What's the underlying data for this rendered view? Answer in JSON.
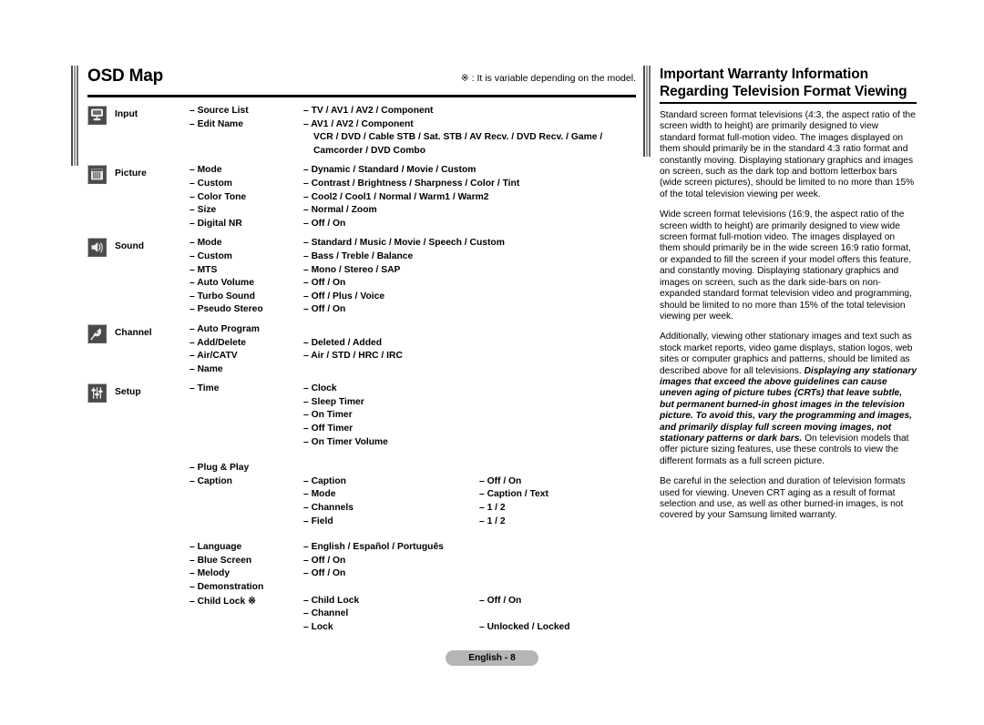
{
  "left": {
    "title": "OSD Map",
    "note": "※ : It is variable depending on the model.",
    "groups": [
      {
        "icon": "input-monitor-icon",
        "label": "Input",
        "rows": [
          {
            "c1": "– Source List",
            "c2": "– TV / AV1 / AV2 / Component"
          },
          {
            "c1": "– Edit Name",
            "c2": "– AV1 / AV2 / Component"
          },
          {
            "cont": "VCR / DVD / Cable STB / Sat. STB / AV Recv. / DVD Recv. / Game /"
          },
          {
            "cont": "Camcorder / DVD Combo"
          }
        ]
      },
      {
        "icon": "picture-blinds-icon",
        "label": "Picture",
        "rows": [
          {
            "c1": "– Mode",
            "c2": "– Dynamic / Standard / Movie / Custom"
          },
          {
            "c1": "– Custom",
            "c2": "– Contrast / Brightness / Sharpness / Color / Tint"
          },
          {
            "c1": "– Color Tone",
            "c2": "– Cool2 / Cool1 / Normal / Warm1 / Warm2"
          },
          {
            "c1": "– Size",
            "c2": "– Normal / Zoom"
          },
          {
            "c1": "– Digital NR",
            "c2": "– Off / On"
          }
        ]
      },
      {
        "icon": "sound-speaker-icon",
        "label": "Sound",
        "rows": [
          {
            "c1": "– Mode",
            "c2": "– Standard / Music / Movie / Speech / Custom"
          },
          {
            "c1": "– Custom",
            "c2": "– Bass / Treble / Balance"
          },
          {
            "c1": "– MTS",
            "c2": "– Mono / Stereo / SAP"
          },
          {
            "c1": "– Auto Volume",
            "c2": "– Off / On"
          },
          {
            "c1": "– Turbo Sound",
            "c2": "– Off / Plus / Voice"
          },
          {
            "c1": "– Pseudo Stereo",
            "c2": "– Off / On"
          }
        ]
      },
      {
        "icon": "channel-satellite-dish-icon",
        "label": "Channel",
        "rows": [
          {
            "c1": "– Auto Program"
          },
          {
            "c1": "– Add/Delete",
            "c2": "– Deleted / Added"
          },
          {
            "c1": "– Air/CATV",
            "c2": "– Air / STD / HRC / IRC"
          },
          {
            "c1": "– Name"
          }
        ]
      },
      {
        "icon": "setup-sliders-icon",
        "label": "Setup",
        "rows": [
          {
            "c1": "– Time",
            "c2": "– Clock"
          },
          {
            "c2": "– Sleep Timer"
          },
          {
            "c2": "– On Timer"
          },
          {
            "c2": "– Off Timer"
          },
          {
            "c2": "– On Timer Volume"
          },
          {
            "spacer": true
          },
          {
            "c1": "– Plug & Play"
          },
          {
            "c1": "– Caption",
            "c2": "– Caption",
            "c4": "– Off / On"
          },
          {
            "c2": "– Mode",
            "c4": "– Caption / Text"
          },
          {
            "c2": "– Channels",
            "c4": "– 1 / 2"
          },
          {
            "c2": "– Field",
            "c4": "– 1 / 2"
          },
          {
            "spacer": true
          },
          {
            "c1": "– Language",
            "c2": "– English / Español / Português"
          },
          {
            "c1": "– Blue Screen",
            "c2": "– Off / On"
          },
          {
            "c1": "– Melody",
            "c2": "– Off / On"
          },
          {
            "c1": "– Demonstration"
          },
          {
            "c1": "– Child Lock ※",
            "c2": "– Child Lock",
            "c4": "– Off / On"
          },
          {
            "c2": "– Channel"
          },
          {
            "c2": "– Lock",
            "c4": "– Unlocked / Locked"
          }
        ]
      }
    ]
  },
  "right": {
    "title_line1": "Important Warranty Information",
    "title_line2": "Regarding Television Format Viewing",
    "paragraphs": [
      {
        "parts": [
          {
            "text": "Standard screen format televisions (4:3, the aspect ratio of the screen width to height) are primarily designed to view standard format full-motion video. The images displayed on them should primarily be in the standard 4:3 ratio format and constantly moving. Displaying stationary graphics and images on screen, such as the dark top and bottom letterbox bars (wide screen pictures), should be limited to no more than 15% of the total television viewing per week.",
            "em": false
          }
        ]
      },
      {
        "parts": [
          {
            "text": "Wide screen format televisions (16:9, the aspect ratio of the screen width to height) are primarily designed to view wide screen format full-motion video. The images displayed on them should primarily be in the wide screen 16:9 ratio format, or expanded to fill the screen if your model offers this feature, and constantly moving. Displaying stationary graphics and images on screen, such as the dark side-bars on non-expanded standard format television video and programming, should be limited to no more than 15% of the total television viewing per week.",
            "em": false
          }
        ]
      },
      {
        "parts": [
          {
            "text": "Additionally, viewing other stationary images and text such as stock market reports, video game displays, station logos, web sites or computer graphics and patterns, should be limited as described above for all televisions. ",
            "em": false
          },
          {
            "text": "Displaying any stationary images that exceed the above guidelines can cause uneven aging of picture tubes (CRTs) that leave subtle, but permanent burned-in ghost images in the television picture. To avoid this, vary the programming and images, and primarily display full screen moving images, not stationary patterns or dark bars.",
            "em": true
          },
          {
            "text": " On television models that offer picture sizing features, use these controls to view the different formats as a full screen picture.",
            "em": false
          }
        ]
      },
      {
        "parts": [
          {
            "text": "Be careful in the selection and duration of television formats used for viewing. Uneven CRT aging as a result of format selection and use, as well as other burned-in images, is not covered by your Samsung limited warranty.",
            "em": false
          }
        ]
      }
    ]
  },
  "footer": {
    "page_label": "English - 8"
  },
  "colors": {
    "icon_background": "#4a4a4a",
    "rule": "#000000",
    "badge": "#b5b5b5",
    "text": "#000000"
  }
}
